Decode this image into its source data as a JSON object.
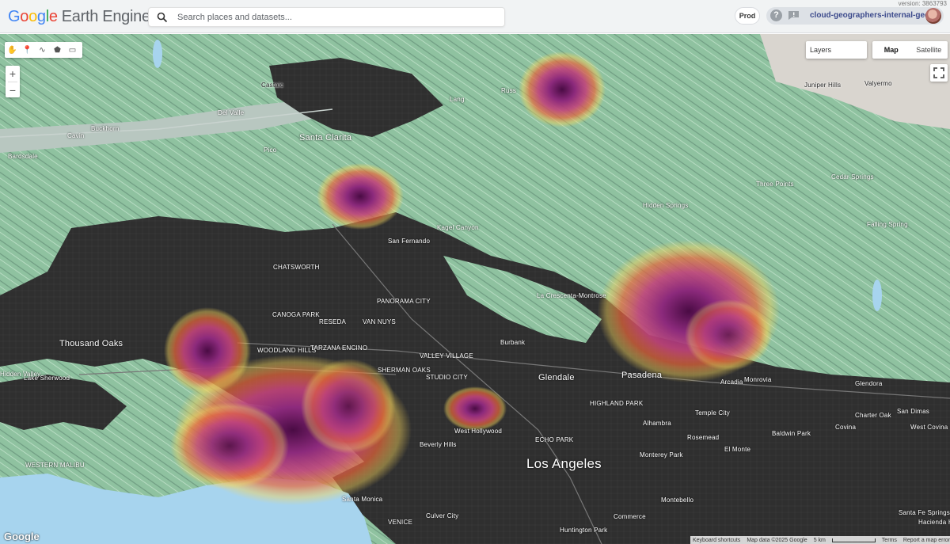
{
  "app": {
    "version": "version: 3863793",
    "logo_google": [
      "G",
      "o",
      "o",
      "g",
      "l",
      "e"
    ],
    "logo_rest": "Earth Engine"
  },
  "search": {
    "placeholder": "Search places and datasets..."
  },
  "header": {
    "env_button": "Prod",
    "help": "?",
    "account_name": "cloud-geographers-internal-gee"
  },
  "map_controls": {
    "layers_label": "Layers",
    "map_type": [
      "Map",
      "Satellite"
    ],
    "zoom_in": "+",
    "zoom_out": "−"
  },
  "map_labels": [
    {
      "text": "Castaic",
      "cls": "dark"
    },
    {
      "text": "Santa Clarita",
      "cls": "big"
    },
    {
      "text": "Del Valle",
      "cls": ""
    },
    {
      "text": "Pico",
      "cls": ""
    },
    {
      "text": "Cavin",
      "cls": ""
    },
    {
      "text": "Bardsdale",
      "cls": ""
    },
    {
      "text": "Buckhorn",
      "cls": ""
    },
    {
      "text": "Lang",
      "cls": ""
    },
    {
      "text": "Russ",
      "cls": ""
    },
    {
      "text": "Valyermo",
      "cls": "dark"
    },
    {
      "text": "Juniper Hills",
      "cls": "dark"
    },
    {
      "text": "Three Points",
      "cls": ""
    },
    {
      "text": "Hidden Springs",
      "cls": ""
    },
    {
      "text": "Cedar Springs",
      "cls": ""
    },
    {
      "text": "Falling Spring",
      "cls": ""
    },
    {
      "text": "Kagel Canyon",
      "cls": ""
    },
    {
      "text": "San Fernando",
      "cls": ""
    },
    {
      "text": "Thousand Oaks",
      "cls": "big"
    },
    {
      "text": "Lake Sherwood",
      "cls": ""
    },
    {
      "text": "Hidden Valley",
      "cls": ""
    },
    {
      "text": "CANOGA PARK",
      "cls": ""
    },
    {
      "text": "RESEDA",
      "cls": ""
    },
    {
      "text": "VAN NUYS",
      "cls": ""
    },
    {
      "text": "CHATSWORTH",
      "cls": ""
    },
    {
      "text": "PANORAMA CITY",
      "cls": ""
    },
    {
      "text": "Burbank",
      "cls": ""
    },
    {
      "text": "La Crescenta-Montrose",
      "cls": ""
    },
    {
      "text": "Glendale",
      "cls": "big"
    },
    {
      "text": "Pasadena",
      "cls": "big"
    },
    {
      "text": "Monrovia",
      "cls": ""
    },
    {
      "text": "Arcadia",
      "cls": ""
    },
    {
      "text": "Temple City",
      "cls": ""
    },
    {
      "text": "Glendora",
      "cls": ""
    },
    {
      "text": "Covina",
      "cls": ""
    },
    {
      "text": "Baldwin Park",
      "cls": ""
    },
    {
      "text": "El Monte",
      "cls": ""
    },
    {
      "text": "Rosemead",
      "cls": ""
    },
    {
      "text": "Monterey Park",
      "cls": ""
    },
    {
      "text": "Alhambra",
      "cls": ""
    },
    {
      "text": "Beverly Hills",
      "cls": ""
    },
    {
      "text": "Los Angeles",
      "cls": "huge"
    },
    {
      "text": "Santa Monica",
      "cls": ""
    },
    {
      "text": "Culver City",
      "cls": ""
    },
    {
      "text": "Montebello",
      "cls": ""
    },
    {
      "text": "Commerce",
      "cls": ""
    },
    {
      "text": "Huntington Park",
      "cls": ""
    },
    {
      "text": "WOODLAND HILLS",
      "cls": ""
    },
    {
      "text": "TARZANA",
      "cls": ""
    },
    {
      "text": "ENCINO",
      "cls": ""
    },
    {
      "text": "SHERMAN OAKS",
      "cls": ""
    },
    {
      "text": "STUDIO CITY",
      "cls": ""
    },
    {
      "text": "VALLEY VILLAGE",
      "cls": ""
    },
    {
      "text": "West Hollywood",
      "cls": ""
    },
    {
      "text": "HIGHLAND PARK",
      "cls": ""
    },
    {
      "text": "ECHO PARK",
      "cls": ""
    },
    {
      "text": "VENICE",
      "cls": ""
    },
    {
      "text": "WESTERN MALIBU",
      "cls": ""
    },
    {
      "text": "Santa Fe Springs",
      "cls": ""
    },
    {
      "text": "Hacienda Heights",
      "cls": ""
    },
    {
      "text": "Charter Oak",
      "cls": ""
    },
    {
      "text": "San Dimas",
      "cls": ""
    },
    {
      "text": "West Covina",
      "cls": ""
    }
  ],
  "footer": {
    "google": "Google",
    "keyboard": "Keyboard shortcuts",
    "map_data": "Map data ©2025 Google",
    "scale": "5 km",
    "terms": "Terms",
    "report": "Report a map error"
  },
  "colors": {
    "urban": "#2b2b2b",
    "terrain": "#93c8a5",
    "ocean": "#a7d4ee",
    "heat_hot": "#5b0f4f",
    "heat_mid": "#9b2f86",
    "heat_warm": "#e8663a",
    "heat_edge": "#f4d25a"
  }
}
